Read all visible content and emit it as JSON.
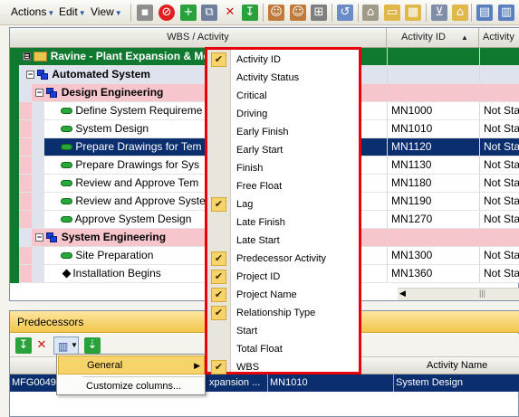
{
  "toolbar": {
    "menus": [
      "Actions",
      "Edit",
      "View"
    ]
  },
  "grid": {
    "columns": {
      "wbs": "WBS / Activity",
      "activity_id": "Activity ID",
      "activity_s": "Activity S"
    },
    "sort_indicator": "▲",
    "rows": [
      {
        "kind": "project",
        "name": "Ravine - Plant Expansion & Mo",
        "id": "",
        "status": ""
      },
      {
        "kind": "wbs1",
        "name": "Automated System",
        "id": "",
        "status": ""
      },
      {
        "kind": "wbs2",
        "name": "Design Engineering",
        "id": "",
        "status": ""
      },
      {
        "kind": "activity",
        "name": "Define System Requireme",
        "id": "MN1000",
        "status": "Not Sta"
      },
      {
        "kind": "activity",
        "name": "System Design",
        "id": "MN1010",
        "status": "Not Sta"
      },
      {
        "kind": "activity-selected",
        "name": "Prepare Drawings for Tem",
        "id": "MN1120",
        "status": "Not Sta"
      },
      {
        "kind": "activity",
        "name": "Prepare Drawings for Sys",
        "id": "MN1130",
        "status": "Not Sta"
      },
      {
        "kind": "activity",
        "name": "Review and Approve Tem",
        "id": "MN1180",
        "status": "Not Sta"
      },
      {
        "kind": "activity",
        "name": "Review and Approve Syste",
        "id": "MN1190",
        "status": "Not Sta"
      },
      {
        "kind": "activity",
        "name": "Approve System Design",
        "id": "MN1270",
        "status": "Not Sta"
      },
      {
        "kind": "wbs2",
        "name": "System Engineering",
        "id": "",
        "status": ""
      },
      {
        "kind": "activity",
        "name": "Site Preparation",
        "id": "MN1300",
        "status": "Not Sta"
      },
      {
        "kind": "milestone",
        "name": "Installation Begins",
        "id": "MN1360",
        "status": "Not Sta"
      }
    ]
  },
  "predecessors": {
    "title": "Predecessors",
    "header": {
      "activity_name": "Activity Name"
    },
    "row": {
      "id": "MFG0049",
      "project": "xpansion ...",
      "activity_id": "MN1010",
      "activity_name": "System Design"
    }
  },
  "context_menu": {
    "items": [
      {
        "label": "General",
        "arrow": "▶"
      },
      {
        "label": "Customize columns..."
      }
    ]
  },
  "column_picker": {
    "items": [
      {
        "label": "Activity ID",
        "checked": true
      },
      {
        "label": "Activity Status",
        "checked": false
      },
      {
        "label": "Critical",
        "checked": false
      },
      {
        "label": "Driving",
        "checked": false
      },
      {
        "label": "Early Finish",
        "checked": false
      },
      {
        "label": "Early Start",
        "checked": false
      },
      {
        "label": "Finish",
        "checked": false
      },
      {
        "label": "Free Float",
        "checked": false
      },
      {
        "label": "Lag",
        "checked": true
      },
      {
        "label": "Late Finish",
        "checked": false
      },
      {
        "label": "Late Start",
        "checked": false
      },
      {
        "label": "Predecessor Activity",
        "checked": true
      },
      {
        "label": "Project ID",
        "checked": true
      },
      {
        "label": "Project Name",
        "checked": true
      },
      {
        "label": "Relationship Type",
        "checked": true
      },
      {
        "label": "Start",
        "checked": false
      },
      {
        "label": "Total Float",
        "checked": false
      },
      {
        "label": "WBS",
        "checked": true
      }
    ],
    "check_glyph": "✔"
  },
  "colors": {
    "selected_row": "#0b2e6e",
    "project_row": "#0f7a2f",
    "wbs1_row": "#dfe3ee",
    "wbs2_row": "#f7c5cc",
    "picker_border": "#e8000a"
  }
}
